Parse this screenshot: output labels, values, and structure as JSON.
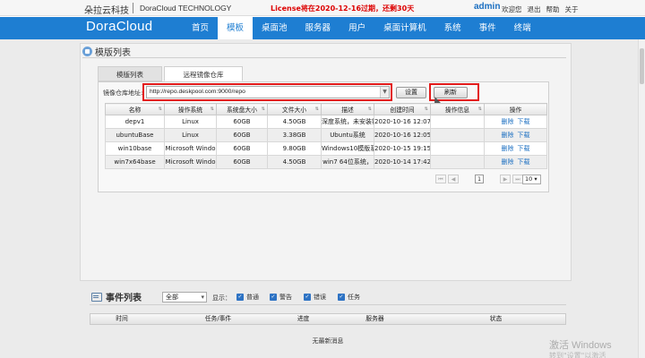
{
  "top": {
    "brand": "朵拉云科技",
    "brand_en": "DoraCloud TECHNOLOGY",
    "license": "License将在2020-12-16过期，还剩30天",
    "user": "admin",
    "links": [
      "欢迎您",
      "退出",
      "帮助",
      "关于"
    ]
  },
  "nav": {
    "logo": "DoraCloud",
    "items": [
      "首页",
      "模板",
      "桌面池",
      "服务器",
      "用户",
      "桌面计算机",
      "系统",
      "事件",
      "终端"
    ],
    "active_index": 1,
    "active_color": "#1e7ed2"
  },
  "panel": {
    "title": "模版列表",
    "tabs": [
      "模版列表",
      "远程镜像仓库"
    ],
    "repo_label": "镜像仓库地址:",
    "repo_url": "http://repo.deskpool.com:9000/repo",
    "btn_set": "设置",
    "btn_refresh": "刷新"
  },
  "table": {
    "headers": [
      "名称",
      "操作系统",
      "系统盘大小",
      "文件大小",
      "描述",
      "创建时间",
      "操作信息",
      "操作"
    ],
    "rows": [
      {
        "name": "depv1",
        "os": "Linux",
        "disk": "60GB",
        "size": "4.50GB",
        "desc": "深度系统，未安装钱",
        "created": "2020-10-16 12:07",
        "info": "",
        "op_delete": "删除",
        "op_download": "下载"
      },
      {
        "name": "ubuntuBase",
        "os": "Linux",
        "disk": "60GB",
        "size": "3.38GB",
        "desc": "Ubuntu系统",
        "created": "2020-10-16 12:05",
        "info": "",
        "op_delete": "删除",
        "op_download": "下载"
      },
      {
        "name": "win10base",
        "os": "Microsoft Windo",
        "disk": "60GB",
        "size": "9.80GB",
        "desc": "Windows10模版系",
        "created": "2020-10-15 19:15",
        "info": "",
        "op_delete": "删除",
        "op_download": "下载"
      },
      {
        "name": "win7x64base",
        "os": "Microsoft Windo",
        "disk": "60GB",
        "size": "4.50GB",
        "desc": "win7 64位系统，",
        "created": "2020-10-14 17:42",
        "info": "",
        "op_delete": "删除",
        "op_download": "下载"
      }
    ]
  },
  "pager": {
    "current": "1",
    "page_size": "10"
  },
  "events": {
    "title": "事件列表",
    "filter": "全部",
    "show_label": "显示：",
    "checks": [
      "普通",
      "警告",
      "错误",
      "任务"
    ],
    "headers": [
      "时间",
      "任务/事件",
      "进度",
      "服务器",
      "状态"
    ],
    "empty": "无最新消息"
  },
  "watermark": {
    "line1": "激活 Windows",
    "line2": "转到\"设置\"以激活 Windows。"
  }
}
